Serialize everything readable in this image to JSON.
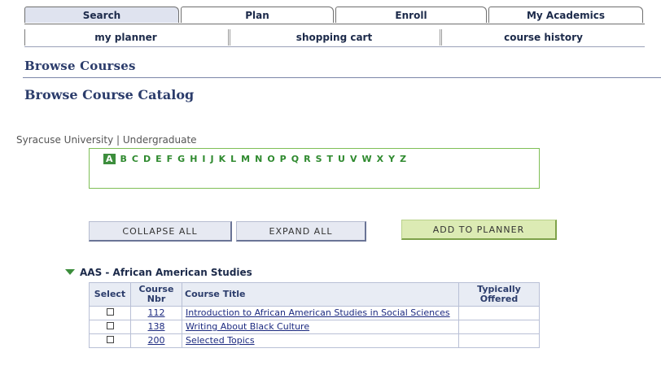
{
  "top_tabs": [
    "Search",
    "Plan",
    "Enroll",
    "My Academics"
  ],
  "sub_tabs": [
    "my planner",
    "shopping cart",
    "course history"
  ],
  "page_heading": "Browse Courses",
  "section_heading": "Browse Course Catalog",
  "institution": "Syracuse University | Undergraduate",
  "alphabet": [
    "A",
    "B",
    "C",
    "D",
    "E",
    "F",
    "G",
    "H",
    "I",
    "J",
    "K",
    "L",
    "M",
    "N",
    "O",
    "P",
    "Q",
    "R",
    "S",
    "T",
    "U",
    "V",
    "W",
    "X",
    "Y",
    "Z"
  ],
  "active_letter": "A",
  "buttons": {
    "collapse": "COLLAPSE ALL",
    "expand": "EXPAND ALL",
    "add": "ADD TO PLANNER"
  },
  "subject": "AAS - African American Studies",
  "table": {
    "headers": {
      "select": "Select",
      "nbr": "Course Nbr",
      "title": "Course Title",
      "offered": "Typically Offered"
    },
    "rows": [
      {
        "nbr": "112",
        "title": "Introduction to African American Studies in Social Sciences",
        "offered": ""
      },
      {
        "nbr": "138",
        "title": "Writing About Black Culture",
        "offered": ""
      },
      {
        "nbr": "200",
        "title": "Selected Topics",
        "offered": ""
      }
    ]
  }
}
